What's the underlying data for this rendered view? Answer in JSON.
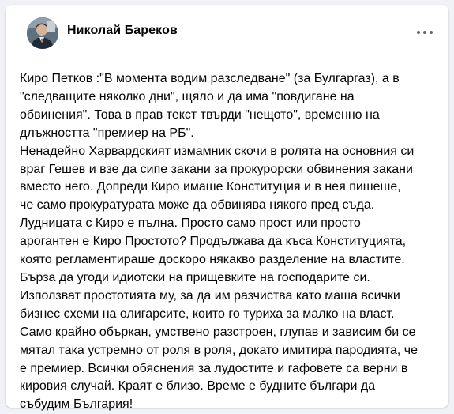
{
  "post": {
    "author": "Николай Бареков",
    "more_icon": "more-horizontal-icon",
    "lines": [
      "Киро Петков :\"В момента водим разследване\" (за Булгаргаз), а в",
      "\"следващите няколко дни\", щяло и да има \"повдигане на",
      "обвинения\".  Това в прав текст твърди \"нещото\", временно на",
      "длъжността \"премиер на РБ\".",
      "Ненадейно Харвардският измамник скочи в ролята на основния си",
      "враг Гешев и взе да сипе закани за прокурорски обвинения закани",
      "вместо него. Допреди Киро имаше Конституция и в нея пишеше,",
      "че само прокуратурата може да обвинява някого пред съда.",
      "Лудницата с Киро е пълна. Просто само прост или просто",
      "арогантен е Киро Простото? Продължава да къса Конституцията,",
      "която регламентираше доскоро някакво  разделение на властите.",
      "Бърза да угоди идиотски на прищевките на господарите си.",
      "Използват простотията му, за да им разчиства като маша всички",
      "бизнес схеми на олигарсите, които го туриха за малко на власт.",
      "Само крайно объркан, умствено разстроен, глупав и зависим би се",
      "мятал така устремно от роля в роля, докато имитира пародията, че",
      "е премиер. Всички обяснения за лудостите и гафовете са верни в",
      "кировия случай. Краят е близо. Време е будните българи да",
      "събудим България!"
    ]
  },
  "colors": {
    "page_bg": "#f0f2f5",
    "card_bg": "#ffffff",
    "text": "#050505",
    "secondary": "#65676b"
  }
}
